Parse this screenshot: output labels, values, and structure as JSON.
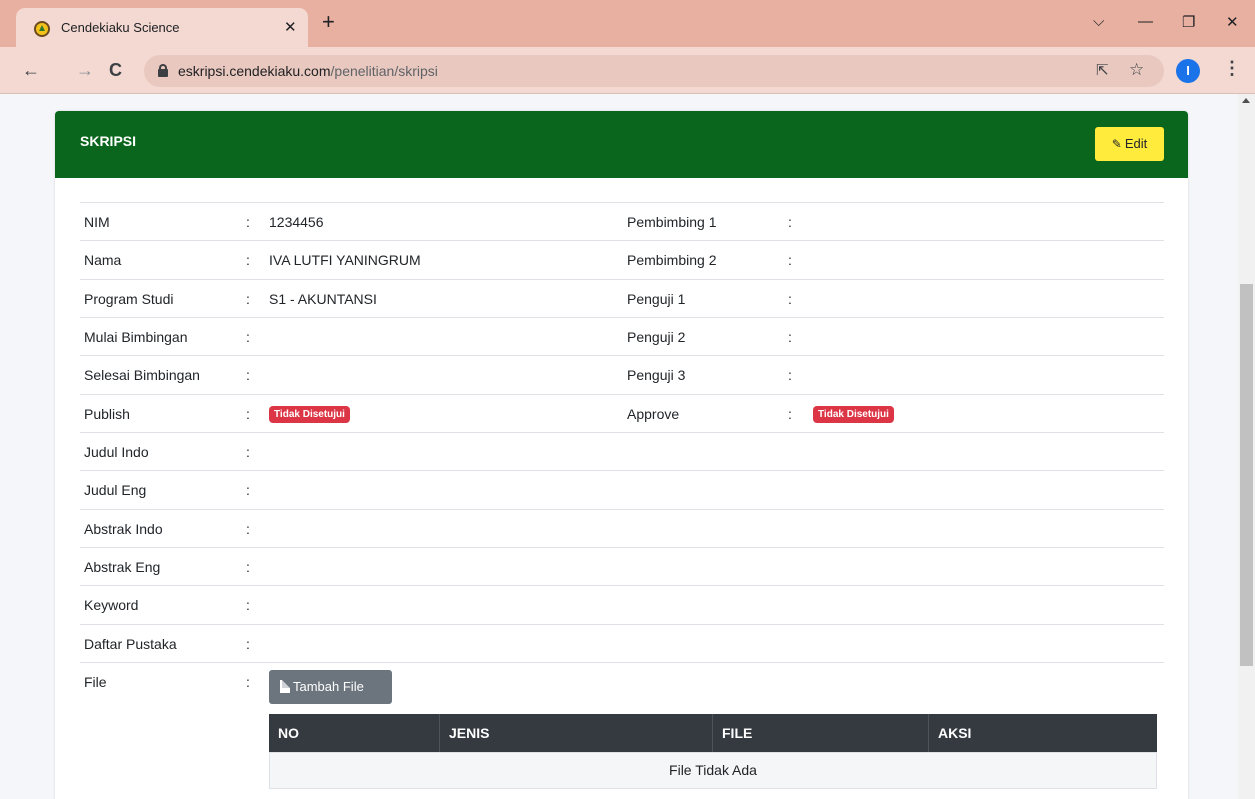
{
  "browser": {
    "tab_title": "Cendekiaku Science",
    "tab_close": "✕",
    "new_tab": "+",
    "url_domain": "eskripsi.cendekiaku.com",
    "url_path": "/penelitian/skripsi",
    "profile_initial": "I",
    "window_controls": {
      "dropdown": "⌵",
      "minimize": "—",
      "restore": "❐",
      "close": "✕"
    }
  },
  "card": {
    "title": "SKRIPSI",
    "edit_label": "Edit"
  },
  "left_fields": [
    {
      "label": "NIM",
      "value": "1234456"
    },
    {
      "label": "Nama",
      "value": "IVA LUTFI YANINGRUM"
    },
    {
      "label": "Program Studi",
      "value": "S1 - AKUNTANSI"
    },
    {
      "label": "Mulai Bimbingan",
      "value": ""
    },
    {
      "label": "Selesai Bimbingan",
      "value": ""
    },
    {
      "label": "Publish",
      "value": "Tidak Disetujui"
    },
    {
      "label": "Judul Indo",
      "value": ""
    },
    {
      "label": "Judul Eng",
      "value": ""
    },
    {
      "label": "Abstrak Indo",
      "value": ""
    },
    {
      "label": "Abstrak Eng",
      "value": ""
    },
    {
      "label": "Keyword",
      "value": ""
    },
    {
      "label": "Daftar Pustaka",
      "value": ""
    },
    {
      "label": "File",
      "value": ""
    }
  ],
  "right_fields": [
    {
      "label": "Pembimbing 1",
      "value": ""
    },
    {
      "label": "Pembimbing 2",
      "value": ""
    },
    {
      "label": "Penguji 1",
      "value": ""
    },
    {
      "label": "Penguji 2",
      "value": ""
    },
    {
      "label": "Penguji 3",
      "value": ""
    },
    {
      "label": "Approve",
      "value": "Tidak Disetujui"
    }
  ],
  "separator": ":",
  "file_section": {
    "add_button": "Tambah File",
    "columns": [
      "NO",
      "JENIS",
      "FILE",
      "AKSI"
    ],
    "empty_message": "File Tidak Ada"
  },
  "colors": {
    "header_green": "#0b661d",
    "edit_yellow": "#ffeb3b",
    "badge_red": "#dc3545",
    "table_head": "#343a40"
  }
}
